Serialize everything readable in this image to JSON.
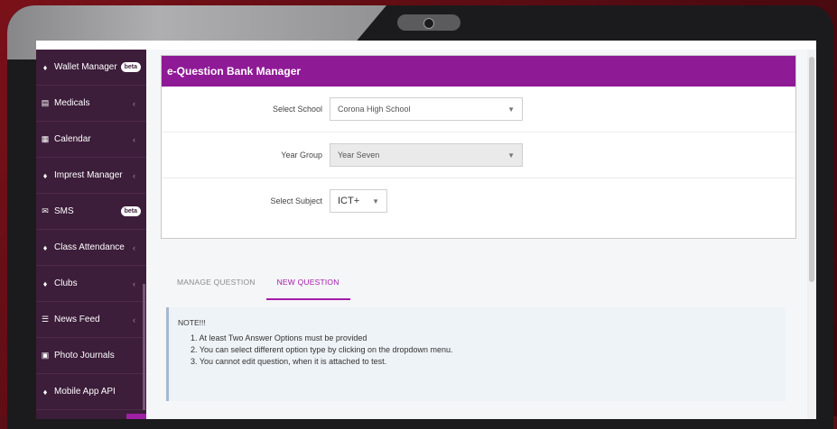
{
  "sidebar": {
    "items": [
      {
        "label": "Wallet Manager",
        "icon": "pin-icon",
        "badge": "beta",
        "chevron": ""
      },
      {
        "label": "Medicals",
        "icon": "document-icon",
        "badge": "",
        "chevron": "‹"
      },
      {
        "label": "Calendar",
        "icon": "calendar-icon",
        "badge": "",
        "chevron": "‹"
      },
      {
        "label": "Imprest Manager",
        "icon": "pin-icon",
        "badge": "",
        "chevron": "‹"
      },
      {
        "label": "SMS",
        "icon": "message-icon",
        "badge": "beta",
        "chevron": ""
      },
      {
        "label": "Class Attendance",
        "icon": "pin-icon",
        "badge": "",
        "chevron": "‹"
      },
      {
        "label": "Clubs",
        "icon": "pin-icon",
        "badge": "",
        "chevron": "‹"
      },
      {
        "label": "News Feed",
        "icon": "news-icon",
        "badge": "",
        "chevron": "‹"
      },
      {
        "label": "Photo Journals",
        "icon": "photo-icon",
        "badge": "",
        "chevron": ""
      },
      {
        "label": "Mobile App API",
        "icon": "pin-icon",
        "badge": "",
        "chevron": ""
      }
    ]
  },
  "panel": {
    "title": "e-Question Bank Manager",
    "fields": {
      "school_label": "Select School",
      "school_value": "Corona High School",
      "year_label": "Year Group",
      "year_value": "Year Seven",
      "subject_label": "Select Subject",
      "subject_value": "ICT+"
    }
  },
  "tabs": [
    {
      "label": "MANAGE QUESTION",
      "active": false
    },
    {
      "label": "NEW QUESTION",
      "active": true
    }
  ],
  "note": {
    "title": "NOTE!!!",
    "lines": [
      "1. At least Two Answer Options must be provided",
      "2. You can select different option type by clicking on the dropdown menu.",
      "3. You cannot edit question, when it is attached to test."
    ]
  },
  "colors": {
    "header": "#8f1a96",
    "sidebar": "#3c1d3a",
    "active_tab": "#a21ca9"
  }
}
